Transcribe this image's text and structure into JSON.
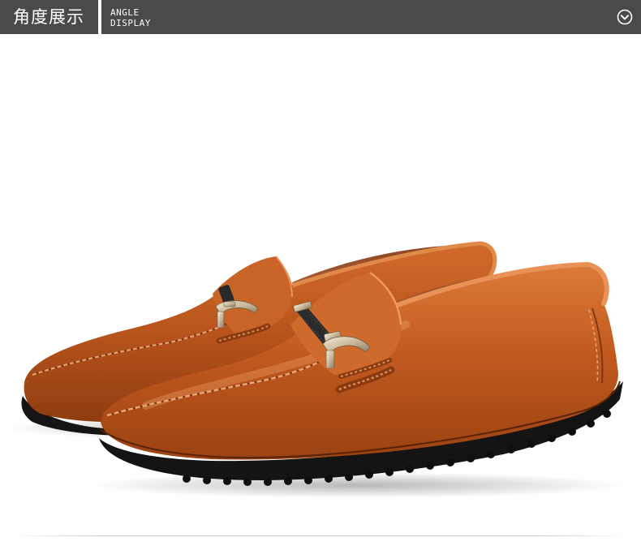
{
  "header": {
    "title_cn": "角度展示",
    "title_en_line1": "ANGLE",
    "title_en_line2": "DISPLAY",
    "icon": "chevron-down-circle-icon",
    "background_color": "#4a4a4a",
    "text_color": "#ffffff"
  },
  "product_image": {
    "subject": "pair of brown leather loafers",
    "leather_color": "#c0561c",
    "sole_color": "#151515"
  }
}
